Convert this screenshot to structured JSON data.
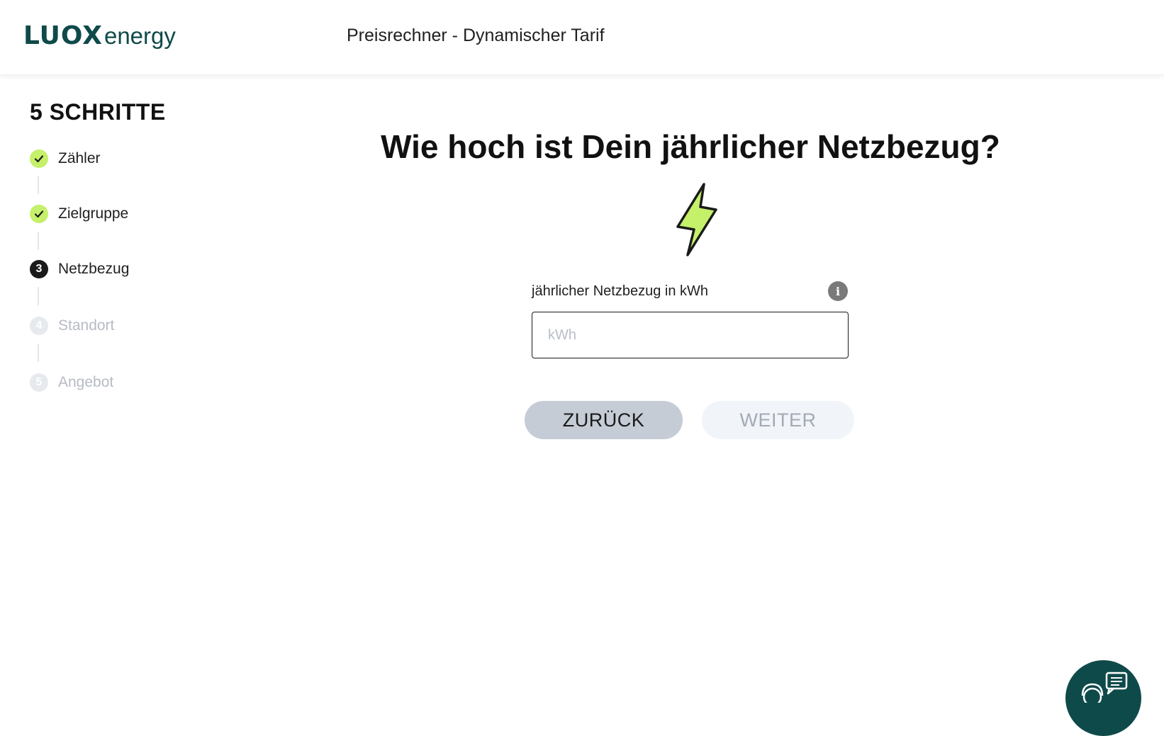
{
  "header": {
    "logo_main": "LUOX",
    "logo_suffix": "energy",
    "title": "Preisrechner - Dynamischer Tarif"
  },
  "sidebar": {
    "heading": "5 SCHRITTE",
    "steps": [
      {
        "label": "Zähler",
        "state": "done",
        "marker": "✓"
      },
      {
        "label": "Zielgruppe",
        "state": "done",
        "marker": "✓"
      },
      {
        "label": "Netzbezug",
        "state": "active",
        "marker": "3"
      },
      {
        "label": "Standort",
        "state": "todo",
        "marker": "4"
      },
      {
        "label": "Angebot",
        "state": "todo",
        "marker": "5"
      }
    ]
  },
  "main": {
    "question": "Wie hoch ist Dein jährlicher Netzbezug?",
    "field_label": "jährlicher Netzbezug in kWh",
    "info_glyph": "i",
    "input_value": "",
    "input_placeholder": "kWh",
    "back_label": "ZURÜCK",
    "next_label": "WEITER"
  },
  "colors": {
    "brand": "#0f4a4a",
    "accent": "#c5f06a",
    "back_button": "#c5ccd6",
    "next_button_disabled": "#f1f4f8"
  },
  "icons": {
    "bolt": "lightning-bolt-icon",
    "check": "check-icon",
    "info": "info-icon",
    "chat": "support-chat-icon"
  }
}
